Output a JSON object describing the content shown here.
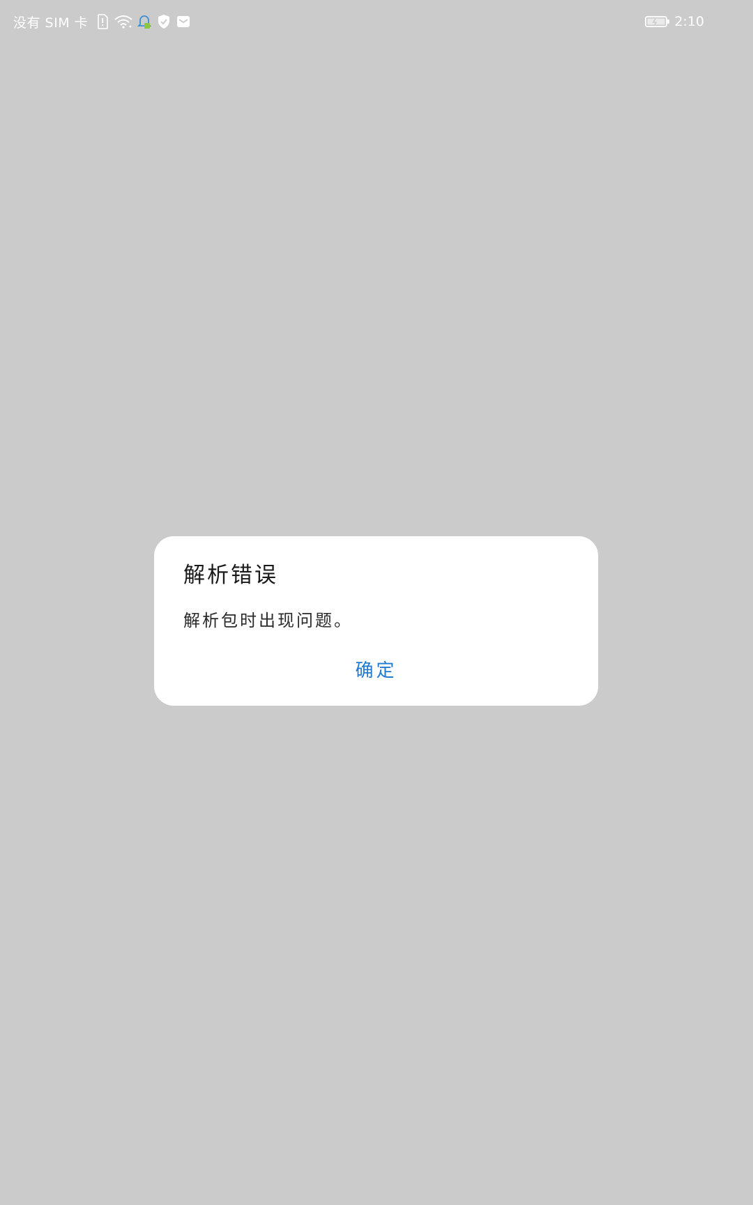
{
  "status_bar": {
    "carrier": "没有 SIM 卡",
    "time": "2:10",
    "icons": [
      "sim-card-icon",
      "wifi-icon",
      "notification-bell-icon",
      "shield-icon",
      "message-icon",
      "battery-charging-icon"
    ]
  },
  "dialog": {
    "title": "解析错误",
    "message": "解析包时出现问题。",
    "confirm_label": "确定"
  },
  "colors": {
    "background": "#cbcbcb",
    "dialog_background": "#ffffff",
    "accent": "#1f7ad3"
  }
}
